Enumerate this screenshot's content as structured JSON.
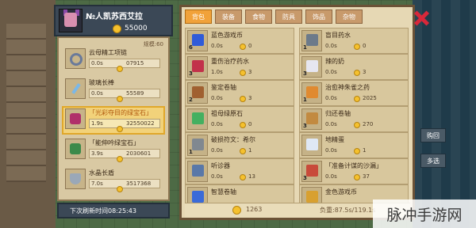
{
  "player": {
    "name": "№人凯苏西艾拉",
    "gold": "55000",
    "fame_label": "规模:60"
  },
  "left_list": [
    {
      "name": "云母精工项链",
      "time": "0.0s",
      "price": "07915",
      "icon": "necklace-icon",
      "highlight": false
    },
    {
      "name": "玻璃长棒",
      "time": "0.0s",
      "price": "55589",
      "icon": "glass-staff-icon",
      "highlight": false
    },
    {
      "name": "「光彩夺目的绿宝石」",
      "time": "1.9s",
      "price": "32550022",
      "icon": "emerald-icon",
      "highlight": true
    },
    {
      "name": "「能伸吟绿宝石」",
      "time": "3.9s",
      "price": "2030601",
      "icon": "emerald-green-icon",
      "highlight": false
    },
    {
      "name": "水晶长盾",
      "time": "7.0s",
      "price": "3517368",
      "icon": "shield-icon",
      "highlight": false
    }
  ],
  "refresh_text": "下次刷新时间08:25:43",
  "tabs": [
    "背包",
    "装备",
    "食物",
    "防具",
    "饰品",
    "杂物"
  ],
  "items": [
    {
      "name": "蓝色游戏币",
      "qty": "6",
      "time": "0.0s",
      "price": "0",
      "color": "#2f5bd8"
    },
    {
      "name": "盲目药水",
      "qty": "1",
      "time": "0.0s",
      "price": "0",
      "color": "#6c7a8a"
    },
    {
      "name": "重伤治疗药水",
      "qty": "3",
      "time": "1.0s",
      "price": "3",
      "color": "#c2314a"
    },
    {
      "name": "辣的奶",
      "qty": "3",
      "time": "0.0s",
      "price": "3",
      "color": "#e6e6f0"
    },
    {
      "name": "鉴定卷轴",
      "qty": "2",
      "time": "0.0s",
      "price": "3",
      "color": "#a06030"
    },
    {
      "name": "治愈神朱雀之药",
      "qty": "1",
      "time": "0.0s",
      "price": "2025",
      "color": "#e08a30"
    },
    {
      "name": "祖母绿原石",
      "qty": "",
      "time": "0.0s",
      "price": "0",
      "color": "#44b060"
    },
    {
      "name": "归还卷轴",
      "qty": "3",
      "time": "0.0s",
      "price": "270",
      "color": "#c28a40"
    },
    {
      "name": "破损符文：希尔",
      "qty": "1",
      "time": "0.0s",
      "price": "1",
      "color": "#808890"
    },
    {
      "name": "地精蛋",
      "qty": "",
      "time": "0.0s",
      "price": "1",
      "color": "#dfe8f5"
    },
    {
      "name": "听诊器",
      "qty": "",
      "time": "0.0s",
      "price": "13",
      "color": "#5a78a8"
    },
    {
      "name": "「准备计谋的沙漏」",
      "qty": "3",
      "time": "0.0s",
      "price": "37",
      "color": "#c84a3a"
    },
    {
      "name": "智慧卷轴",
      "qty": "",
      "time": "",
      "price": "",
      "color": "#3a6ad8"
    },
    {
      "name": "金色游戏币",
      "qty": "",
      "time": "",
      "price": "",
      "color": "#d8a030"
    }
  ],
  "footer": {
    "gold": "1263",
    "weight": "负重:87.5s/119.1s"
  },
  "side_buttons": [
    "购回",
    "多选"
  ],
  "watermark": "脉冲手游网"
}
